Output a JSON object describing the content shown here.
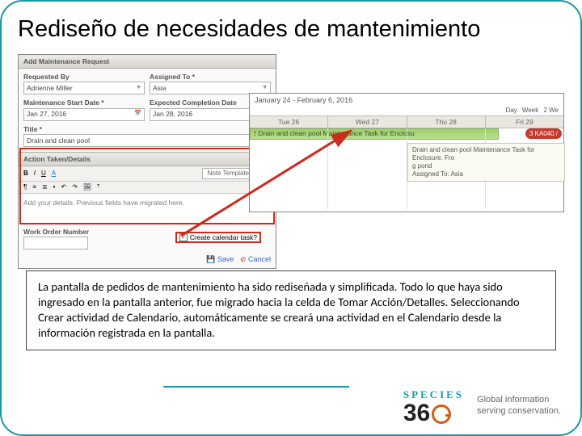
{
  "title": "Rediseño de necesidades de mantenimiento",
  "form": {
    "header": "Add Maintenance Request",
    "requested_by_lbl": "Requested By",
    "requested_by_val": "Adrienne Miller",
    "assigned_to_lbl": "Assigned To *",
    "assigned_to_val": "Asia",
    "start_date_lbl": "Maintenance Start Date *",
    "start_date_val": "Jan 27, 2016",
    "completion_lbl": "Expected Completion Date",
    "completion_val": "Jan 28, 2016",
    "title_lbl": "Title *",
    "title_val": "Drain and clean pool",
    "action_hdr": "Action Taken/Details",
    "templates_lbl": "Note Templates",
    "editor_text": "Add your details. Previous fields have migrated here.",
    "won_lbl": "Work Order Number",
    "create_calendar_lbl": "Create calendar task?",
    "save_lbl": "Save",
    "cancel_lbl": "Cancel",
    "tb": {
      "b": "B",
      "i": "I",
      "u": "U",
      "a": "A"
    }
  },
  "cal": {
    "range": "January 24 - February 6, 2016",
    "tabs": {
      "day": "Day",
      "week": "Week",
      "twoweek": "2 We"
    },
    "cols": {
      "tue": "Tue 26",
      "wed": "Wed 27",
      "thu": "Thu 28",
      "fri": "Fri 29"
    },
    "task_label": "Drain and clean pool Maintenance Task for Enclosu",
    "badge": "3 KA040 /",
    "tooltip_line1": "Drain and clean pool Maintenance Task for Enclosure. Fro",
    "tooltip_line2": "g pond",
    "tooltip_line3": "Assigned To: Asia"
  },
  "caption": "La pantalla de pedidos de mantenimiento ha sido rediseñada y simplificada. Todo lo que haya sido ingresado en la pantalla anterior, fue migrado hacia la celda de Tomar Acción/Detalles. Seleccionando Crear actividad de Calendario, automáticamente se creará una actividad en el Calendario desde la información registrada en la pantalla.",
  "footer": {
    "brand": "SPECIES",
    "n3": "3",
    "n6": "6",
    "tag1": "Global information",
    "tag2": "serving conservation."
  }
}
